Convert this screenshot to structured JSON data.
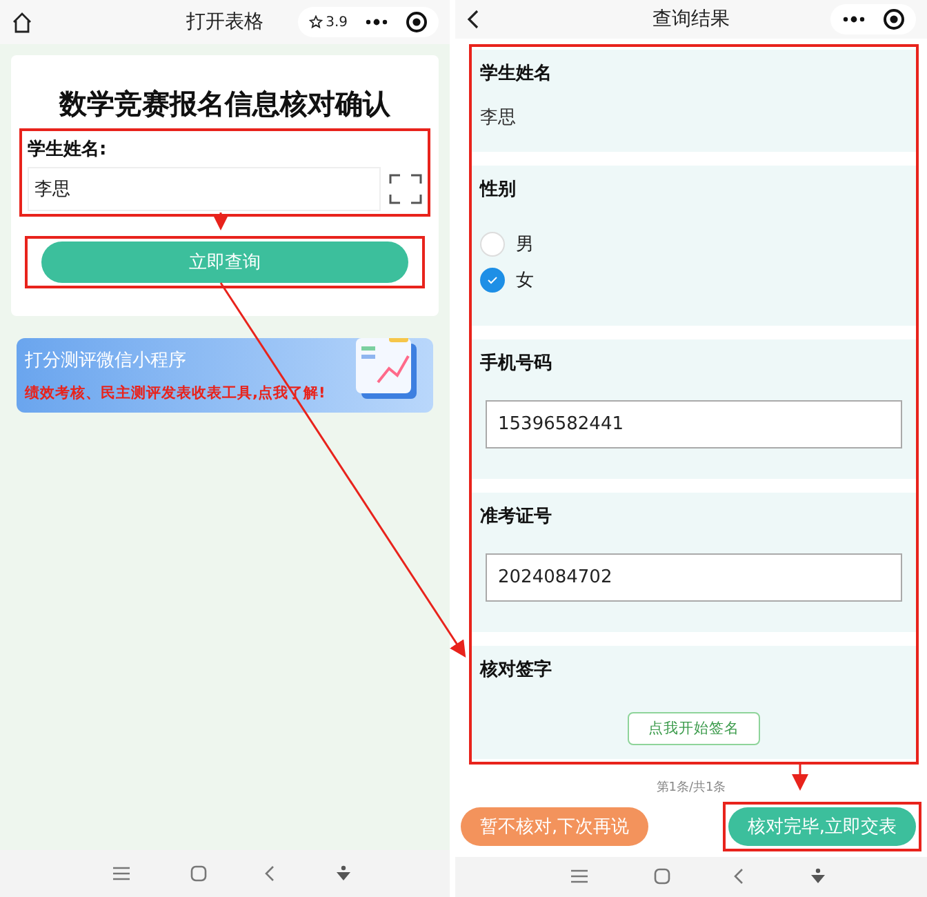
{
  "left": {
    "nav_title": "打开表格",
    "rating": "3.9",
    "form_title": "数学竞赛报名信息核对确认",
    "field_label": "学生姓名:",
    "field_value": "李思",
    "button": "立即查询",
    "banner": {
      "title": "打分测评微信小程序",
      "subtitle": "绩效考核、民主测评发表收表工具,点我了解!"
    }
  },
  "right": {
    "nav_title": "查询结果",
    "sections": [
      {
        "kind": "text",
        "label": "学生姓名",
        "value": "李思"
      },
      {
        "kind": "radio",
        "label": "性别",
        "options": [
          {
            "label": "男",
            "selected": false
          },
          {
            "label": "女",
            "selected": true
          }
        ]
      },
      {
        "kind": "input",
        "label": "手机号码",
        "value": "15396582441"
      },
      {
        "kind": "input",
        "label": "准考证号",
        "value": "2024084702"
      },
      {
        "kind": "signature",
        "label": "核对签字",
        "button": "点我开始签名"
      }
    ],
    "pager": "第1条/共1条",
    "buttons": [
      {
        "kind": "secondary",
        "label": "暂不核对,下次再说"
      },
      {
        "kind": "primary",
        "label": "核对完毕,立即交表"
      }
    ]
  }
}
